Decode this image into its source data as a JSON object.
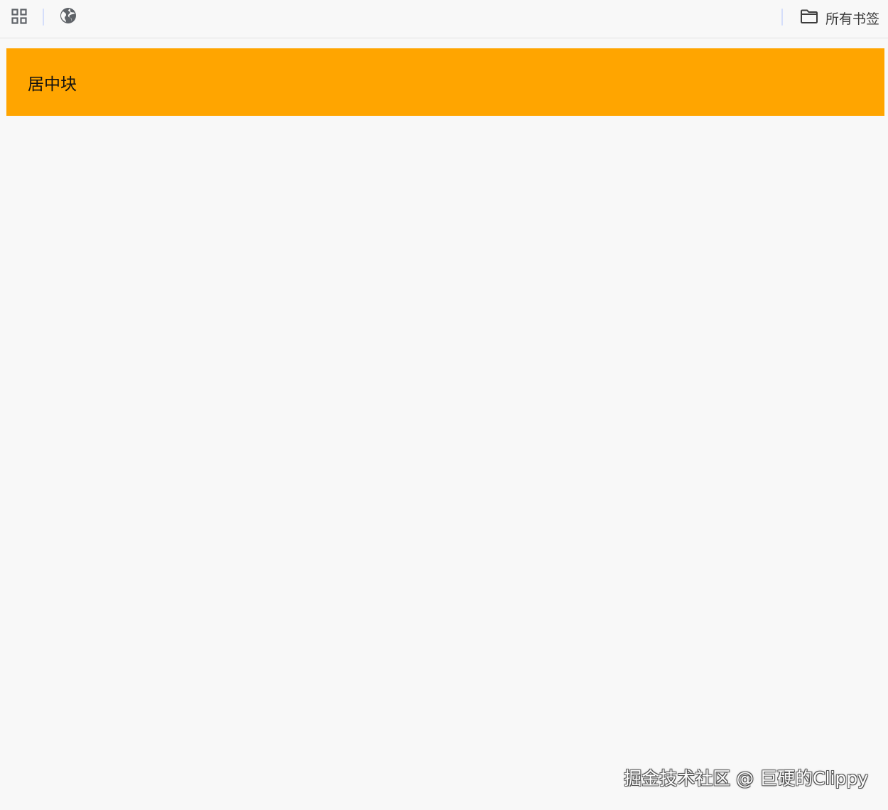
{
  "bookmarks_bar": {
    "apps_icon": "apps-grid-icon",
    "web_icon": "globe-icon",
    "all_bookmarks": {
      "icon": "folder-icon",
      "label": "所有书签"
    },
    "separator_color": "#d5defa",
    "icon_color": "#5f6368"
  },
  "content": {
    "center_block": {
      "text": "居中块",
      "background": "#ffa500"
    }
  },
  "watermark": {
    "text": "掘金技术社区 @ 巨硬的Clippy"
  }
}
